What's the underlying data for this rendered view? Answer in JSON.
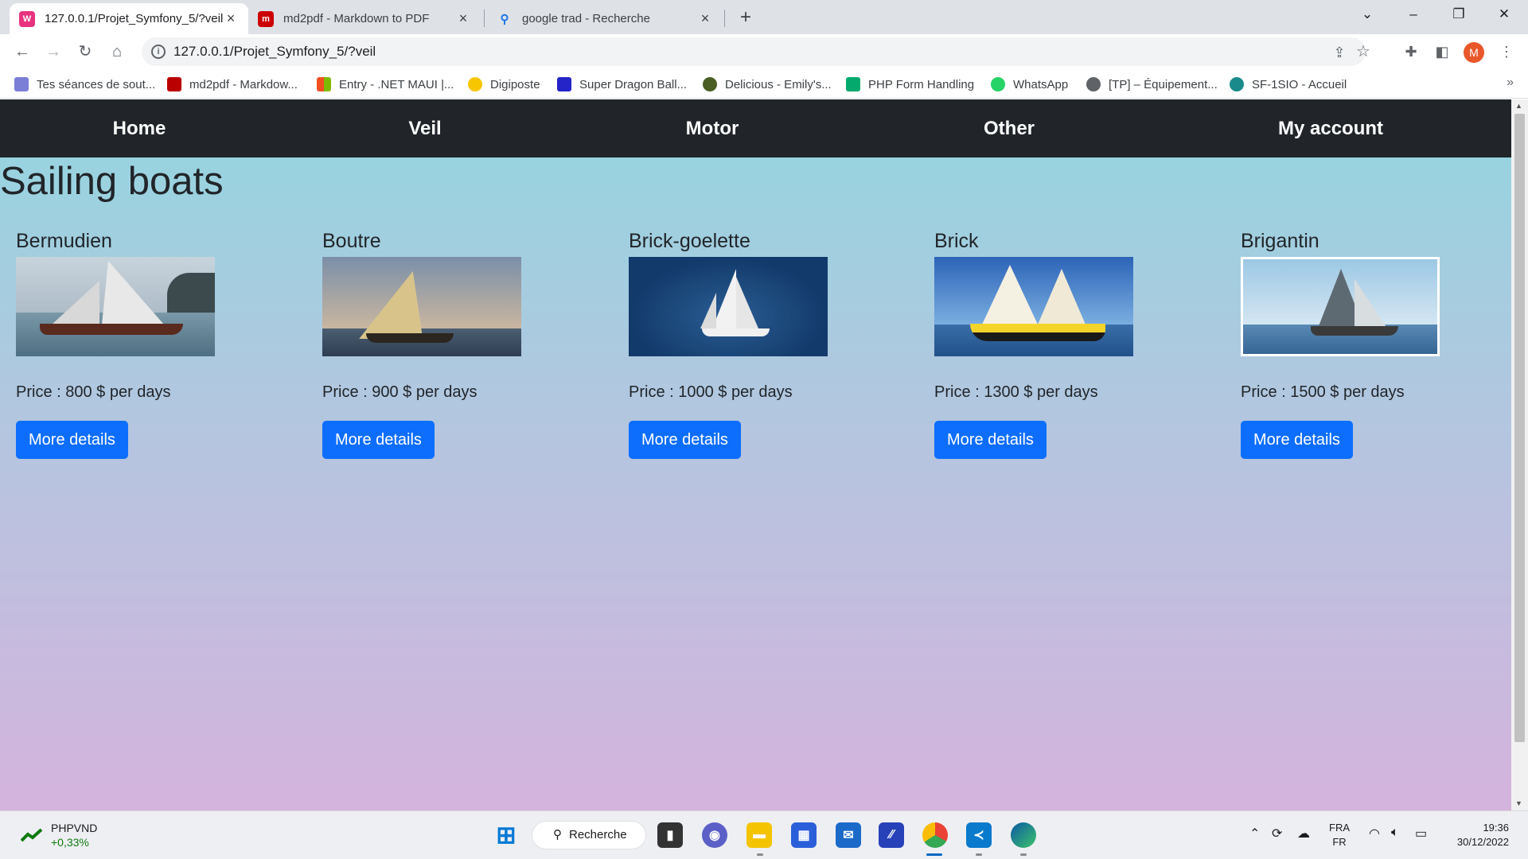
{
  "browser": {
    "tabs": [
      {
        "title": "127.0.0.1/Projet_Symfony_5/?veil",
        "active": true
      },
      {
        "title": "md2pdf - Markdown to PDF",
        "active": false
      },
      {
        "title": "google trad - Recherche",
        "active": false
      }
    ],
    "url": "127.0.0.1/Projet_Symfony_5/?veil",
    "profile_initial": "M",
    "bookmarks": [
      "Tes séances de sout...",
      "md2pdf - Markdow...",
      "Entry - .NET MAUI |...",
      "Digiposte",
      "Super Dragon Ball...",
      "Delicious - Emily's...",
      "PHP Form Handling",
      "WhatsApp",
      "[TP] – Équipement...",
      "SF-1SIO - Accueil"
    ]
  },
  "site": {
    "nav": [
      "Home",
      "Veil",
      "Motor",
      "Other",
      "My account"
    ],
    "page_title": "Sailing boats",
    "boats": [
      {
        "name": "Bermudien",
        "price": "Price : 800 $ per days",
        "button": "More details"
      },
      {
        "name": "Boutre",
        "price": "Price : 900 $ per days",
        "button": "More details"
      },
      {
        "name": "Brick-goelette",
        "price": "Price : 1000 $ per days",
        "button": "More details"
      },
      {
        "name": "Brick",
        "price": "Price : 1300 $ per days",
        "button": "More details"
      },
      {
        "name": "Brigantin",
        "price": "Price : 1500 $ per days",
        "button": "More details"
      }
    ]
  },
  "taskbar": {
    "ticker": "PHPVND",
    "ticker_change": "+0,33%",
    "search": "Recherche",
    "lang_top": "FRA",
    "lang_bottom": "FR",
    "time": "19:36",
    "date": "30/12/2022"
  },
  "colors": {
    "nav_bg": "#212529",
    "button_bg": "#0d6efd",
    "page_gradient_top": "#93d6e0",
    "page_gradient_bottom": "#d4b3dc"
  }
}
